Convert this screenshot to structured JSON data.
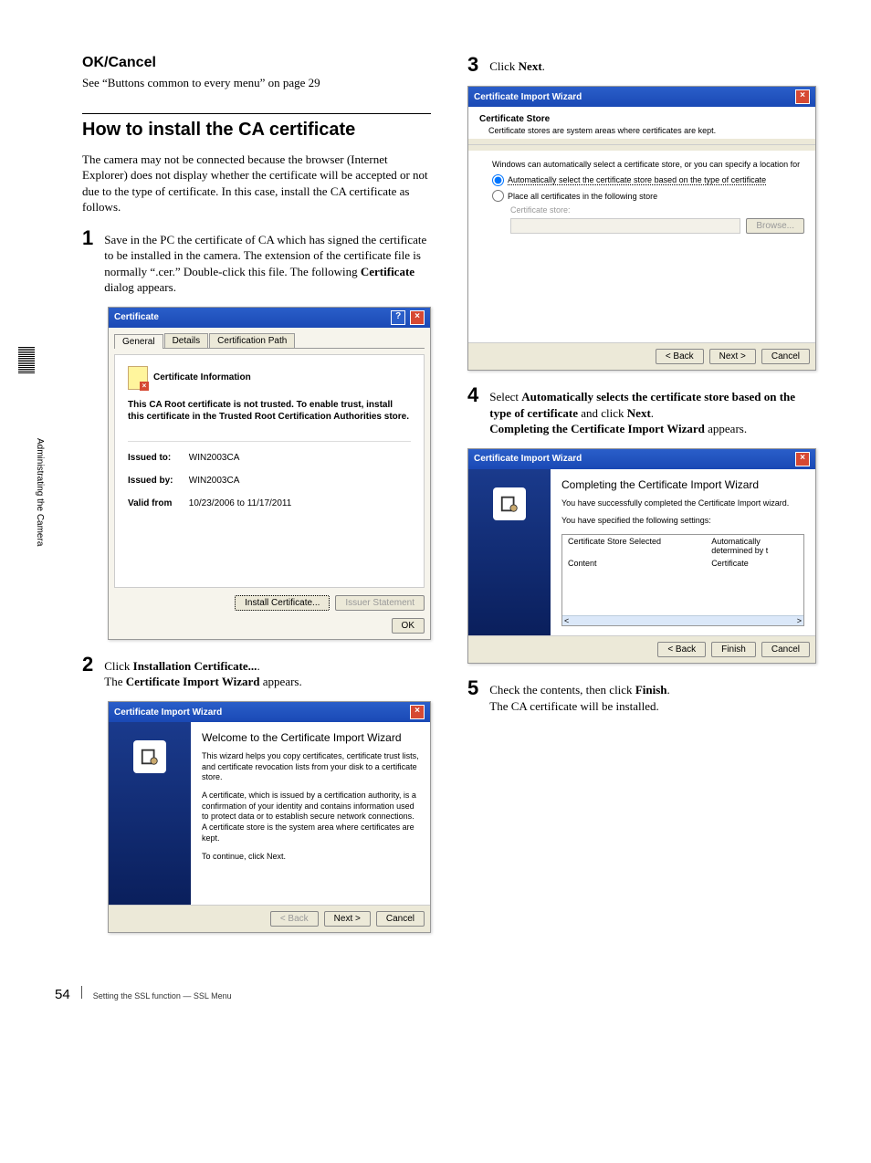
{
  "left": {
    "ok_cancel_title": "OK/Cancel",
    "ok_cancel_text": "See “Buttons common to every menu” on page 29",
    "section_title": "How to install the CA certificate",
    "intro": "The camera may not be connected because the browser (Internet Explorer) does not display whether the certificate will be accepted or not due to the type of certificate. In this case, install the CA certificate as follows.",
    "step1_text_a": "Save in the PC the certificate of CA which has signed the certificate to be installed in the camera. The extension of the certificate file is normally “.cer.” Double-click this file. The following ",
    "step1_text_b": "Certificate",
    "step1_text_c": " dialog appears.",
    "step2_a": "Click ",
    "step2_b": "Installation Certificate...",
    "step2_c": ". ",
    "step2_d": "The ",
    "step2_e": "Certificate Import Wizard",
    "step2_f": " appears."
  },
  "cert_dialog": {
    "title": "Certificate",
    "tab_general": "General",
    "tab_details": "Details",
    "tab_path": "Certification Path",
    "info_title": "Certificate Information",
    "trust_text": "This CA Root certificate is not trusted. To enable trust, install this certificate in the Trusted Root Certification Authorities store.",
    "issued_to_lbl": "Issued to:",
    "issued_to_val": "WIN2003CA",
    "issued_by_lbl": "Issued by:",
    "issued_by_val": "WIN2003CA",
    "valid_lbl": "Valid from",
    "valid_val": "10/23/2006 to 11/17/2011",
    "btn_install": "Install Certificate...",
    "btn_issuer": "Issuer Statement",
    "btn_ok": "OK"
  },
  "wizard1": {
    "title": "Certificate Import Wizard",
    "heading": "Welcome to the Certificate Import Wizard",
    "p1": "This wizard helps you copy certificates, certificate trust lists, and certificate revocation lists from your disk to a certificate store.",
    "p2": "A certificate, which is issued by a certification authority, is a confirmation of your identity and contains information used to protect data or to establish secure network connections. A certificate store is the system area where certificates are kept.",
    "p3": "To continue, click Next.",
    "btn_back": "< Back",
    "btn_next": "Next >",
    "btn_cancel": "Cancel"
  },
  "right": {
    "step3_a": "Click ",
    "step3_b": "Next",
    "step3_c": ".",
    "step4_a": "Select ",
    "step4_b": "Automatically selects the certificate store based on the type of certificate",
    "step4_c": " and click ",
    "step4_d": "Next",
    "step4_e": ". ",
    "step4_f": "Completing the Certificate Import Wizard",
    "step4_g": " appears.",
    "step5_a": "Check the contents, then click ",
    "step5_b": "Finish",
    "step5_c": ". ",
    "step5_d": "The CA certificate will be installed."
  },
  "store_dialog": {
    "title": "Certificate Import Wizard",
    "section_title": "Certificate Store",
    "section_sub": "Certificate stores are system areas where certificates are kept.",
    "intro": "Windows can automatically select a certificate store, or you can specify a location for",
    "radio1": "Automatically select the certificate store based on the type of certificate",
    "radio2": "Place all certificates in the following store",
    "store_lbl": "Certificate store:",
    "btn_browse": "Browse...",
    "btn_back": "< Back",
    "btn_next": "Next >",
    "btn_cancel": "Cancel"
  },
  "wizard2": {
    "title": "Certificate Import Wizard",
    "heading": "Completing the Certificate Import Wizard",
    "p1": "You have successfully completed the Certificate Import wizard.",
    "p2": "You have specified the following settings:",
    "row1a": "Certificate Store Selected",
    "row1b": "Automatically determined by t",
    "row2a": "Content",
    "row2b": "Certificate",
    "btn_back": "< Back",
    "btn_finish": "Finish",
    "btn_cancel": "Cancel"
  },
  "side_label": "Administrating the Camera",
  "footer": {
    "page": "54",
    "text": "Setting the SSL function — SSL Menu"
  }
}
